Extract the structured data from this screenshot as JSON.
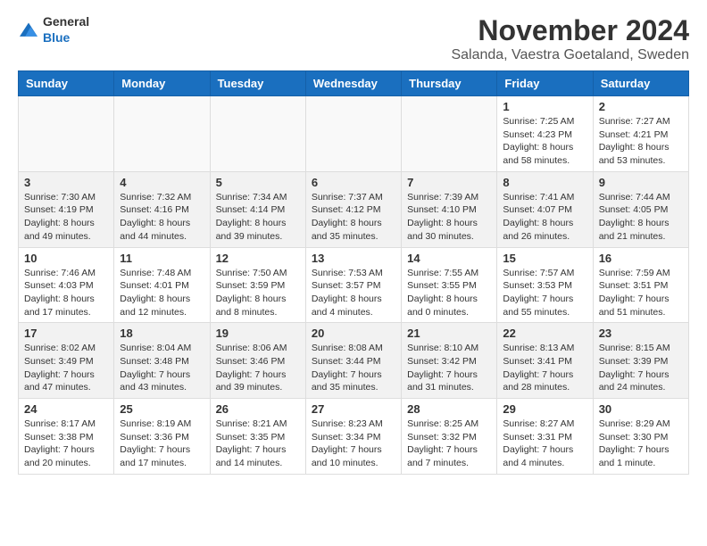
{
  "header": {
    "logo_general": "General",
    "logo_blue": "Blue",
    "month_title": "November 2024",
    "location": "Salanda, Vaestra Goetaland, Sweden"
  },
  "weekdays": [
    "Sunday",
    "Monday",
    "Tuesday",
    "Wednesday",
    "Thursday",
    "Friday",
    "Saturday"
  ],
  "weeks": [
    [
      {
        "day": "",
        "info": ""
      },
      {
        "day": "",
        "info": ""
      },
      {
        "day": "",
        "info": ""
      },
      {
        "day": "",
        "info": ""
      },
      {
        "day": "",
        "info": ""
      },
      {
        "day": "1",
        "info": "Sunrise: 7:25 AM\nSunset: 4:23 PM\nDaylight: 8 hours\nand 58 minutes."
      },
      {
        "day": "2",
        "info": "Sunrise: 7:27 AM\nSunset: 4:21 PM\nDaylight: 8 hours\nand 53 minutes."
      }
    ],
    [
      {
        "day": "3",
        "info": "Sunrise: 7:30 AM\nSunset: 4:19 PM\nDaylight: 8 hours\nand 49 minutes."
      },
      {
        "day": "4",
        "info": "Sunrise: 7:32 AM\nSunset: 4:16 PM\nDaylight: 8 hours\nand 44 minutes."
      },
      {
        "day": "5",
        "info": "Sunrise: 7:34 AM\nSunset: 4:14 PM\nDaylight: 8 hours\nand 39 minutes."
      },
      {
        "day": "6",
        "info": "Sunrise: 7:37 AM\nSunset: 4:12 PM\nDaylight: 8 hours\nand 35 minutes."
      },
      {
        "day": "7",
        "info": "Sunrise: 7:39 AM\nSunset: 4:10 PM\nDaylight: 8 hours\nand 30 minutes."
      },
      {
        "day": "8",
        "info": "Sunrise: 7:41 AM\nSunset: 4:07 PM\nDaylight: 8 hours\nand 26 minutes."
      },
      {
        "day": "9",
        "info": "Sunrise: 7:44 AM\nSunset: 4:05 PM\nDaylight: 8 hours\nand 21 minutes."
      }
    ],
    [
      {
        "day": "10",
        "info": "Sunrise: 7:46 AM\nSunset: 4:03 PM\nDaylight: 8 hours\nand 17 minutes."
      },
      {
        "day": "11",
        "info": "Sunrise: 7:48 AM\nSunset: 4:01 PM\nDaylight: 8 hours\nand 12 minutes."
      },
      {
        "day": "12",
        "info": "Sunrise: 7:50 AM\nSunset: 3:59 PM\nDaylight: 8 hours\nand 8 minutes."
      },
      {
        "day": "13",
        "info": "Sunrise: 7:53 AM\nSunset: 3:57 PM\nDaylight: 8 hours\nand 4 minutes."
      },
      {
        "day": "14",
        "info": "Sunrise: 7:55 AM\nSunset: 3:55 PM\nDaylight: 8 hours\nand 0 minutes."
      },
      {
        "day": "15",
        "info": "Sunrise: 7:57 AM\nSunset: 3:53 PM\nDaylight: 7 hours\nand 55 minutes."
      },
      {
        "day": "16",
        "info": "Sunrise: 7:59 AM\nSunset: 3:51 PM\nDaylight: 7 hours\nand 51 minutes."
      }
    ],
    [
      {
        "day": "17",
        "info": "Sunrise: 8:02 AM\nSunset: 3:49 PM\nDaylight: 7 hours\nand 47 minutes."
      },
      {
        "day": "18",
        "info": "Sunrise: 8:04 AM\nSunset: 3:48 PM\nDaylight: 7 hours\nand 43 minutes."
      },
      {
        "day": "19",
        "info": "Sunrise: 8:06 AM\nSunset: 3:46 PM\nDaylight: 7 hours\nand 39 minutes."
      },
      {
        "day": "20",
        "info": "Sunrise: 8:08 AM\nSunset: 3:44 PM\nDaylight: 7 hours\nand 35 minutes."
      },
      {
        "day": "21",
        "info": "Sunrise: 8:10 AM\nSunset: 3:42 PM\nDaylight: 7 hours\nand 31 minutes."
      },
      {
        "day": "22",
        "info": "Sunrise: 8:13 AM\nSunset: 3:41 PM\nDaylight: 7 hours\nand 28 minutes."
      },
      {
        "day": "23",
        "info": "Sunrise: 8:15 AM\nSunset: 3:39 PM\nDaylight: 7 hours\nand 24 minutes."
      }
    ],
    [
      {
        "day": "24",
        "info": "Sunrise: 8:17 AM\nSunset: 3:38 PM\nDaylight: 7 hours\nand 20 minutes."
      },
      {
        "day": "25",
        "info": "Sunrise: 8:19 AM\nSunset: 3:36 PM\nDaylight: 7 hours\nand 17 minutes."
      },
      {
        "day": "26",
        "info": "Sunrise: 8:21 AM\nSunset: 3:35 PM\nDaylight: 7 hours\nand 14 minutes."
      },
      {
        "day": "27",
        "info": "Sunrise: 8:23 AM\nSunset: 3:34 PM\nDaylight: 7 hours\nand 10 minutes."
      },
      {
        "day": "28",
        "info": "Sunrise: 8:25 AM\nSunset: 3:32 PM\nDaylight: 7 hours\nand 7 minutes."
      },
      {
        "day": "29",
        "info": "Sunrise: 8:27 AM\nSunset: 3:31 PM\nDaylight: 7 hours\nand 4 minutes."
      },
      {
        "day": "30",
        "info": "Sunrise: 8:29 AM\nSunset: 3:30 PM\nDaylight: 7 hours\nand 1 minute."
      }
    ]
  ]
}
